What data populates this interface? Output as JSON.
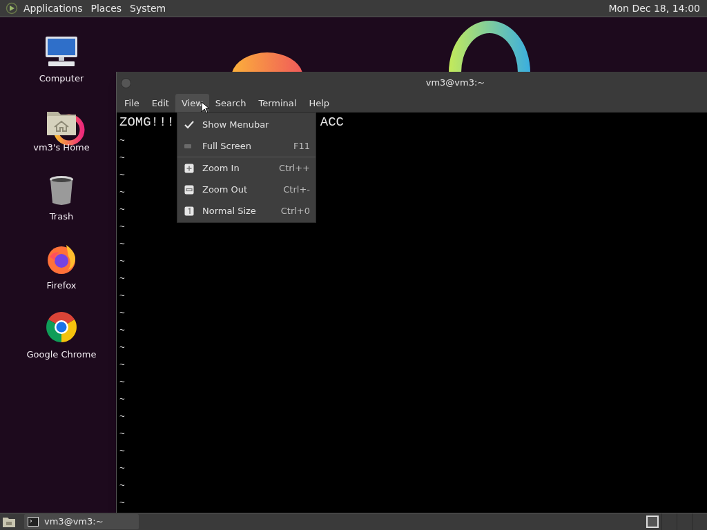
{
  "top_panel": {
    "menus": [
      "Applications",
      "Places",
      "System"
    ],
    "clock": "Mon Dec 18, 14:00"
  },
  "desktop_icons": [
    {
      "kind": "computer",
      "label": "Computer"
    },
    {
      "kind": "home",
      "label": "vm3's Home"
    },
    {
      "kind": "trash",
      "label": "Trash"
    },
    {
      "kind": "firefox",
      "label": "Firefox"
    },
    {
      "kind": "chrome",
      "label": "Google Chrome"
    }
  ],
  "window": {
    "title": "vm3@vm3:~",
    "menubar": [
      {
        "label": "File",
        "selected": false
      },
      {
        "label": "Edit",
        "selected": false
      },
      {
        "label": "View",
        "selected": true
      },
      {
        "label": "Search",
        "selected": false
      },
      {
        "label": "Terminal",
        "selected": false
      },
      {
        "label": "Help",
        "selected": false
      }
    ],
    "terminal": {
      "first_line": [
        "ZOMG!!!",
        "ACC"
      ],
      "lines": [
        "~",
        "~",
        "~",
        "~",
        "~",
        "~",
        "~",
        "~",
        "~",
        "~",
        "~",
        "~",
        "~",
        "~",
        "~",
        "~",
        "~",
        "~",
        "~",
        "~",
        "~",
        "~"
      ]
    },
    "view_menu": [
      {
        "kind": "check",
        "label": "Show Menubar",
        "checked": true,
        "separator_after": false
      },
      {
        "kind": "check",
        "label": "Full Screen",
        "shortcut": "F11",
        "checked": false,
        "separator_after": true
      },
      {
        "kind": "zoom_in",
        "label": "Zoom In",
        "shortcut": "Ctrl++",
        "separator_after": false
      },
      {
        "kind": "zoom_out",
        "label": "Zoom Out",
        "shortcut": "Ctrl+-",
        "separator_after": false
      },
      {
        "kind": "zoom_reset",
        "label": "Normal Size",
        "shortcut": "Ctrl+0",
        "separator_after": false
      }
    ]
  },
  "taskbar": {
    "tasks": [
      {
        "label": "vm3@vm3:~",
        "selected": false
      }
    ]
  }
}
